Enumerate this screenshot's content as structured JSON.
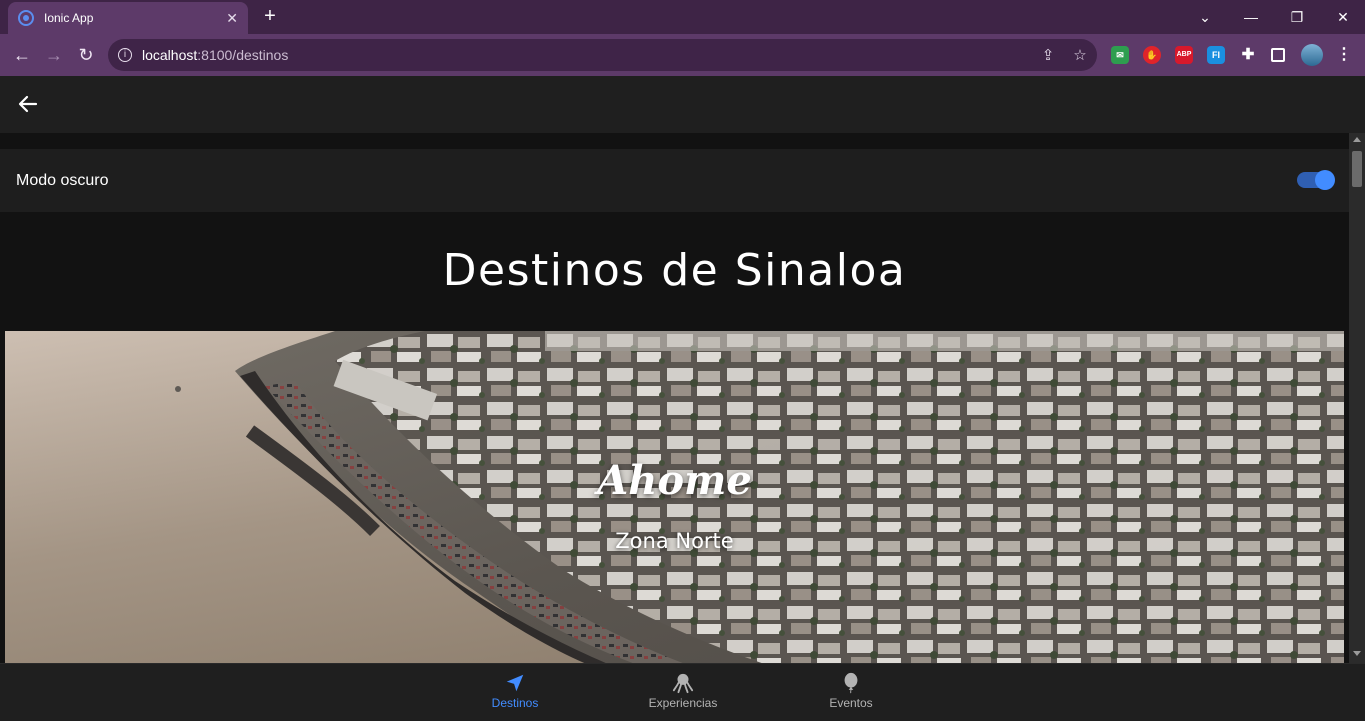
{
  "browser": {
    "tab_title": "Ionic App",
    "tab_close": "✕",
    "new_tab": "+",
    "url_host": "localhost",
    "url_path": ":8100/destinos"
  },
  "extensions": {
    "abp": "ABP",
    "fi": "FI"
  },
  "settings": {
    "dark_mode_label": "Modo oscuro",
    "dark_mode_on": true
  },
  "page": {
    "title": "Destinos de Sinaloa"
  },
  "destination": {
    "name": "Ahome",
    "zone": "Zona Norte"
  },
  "tabs": [
    {
      "label": "Destinos",
      "icon": "navigate-icon",
      "active": true
    },
    {
      "label": "Experiencias",
      "icon": "octopus-icon",
      "active": false
    },
    {
      "label": "Eventos",
      "icon": "balloon-icon",
      "active": false
    }
  ],
  "colors": {
    "accent": "#428cff",
    "browser_frame": "#3e2446",
    "browser_toolbar": "#5d3a69",
    "app_background": "#121212"
  }
}
